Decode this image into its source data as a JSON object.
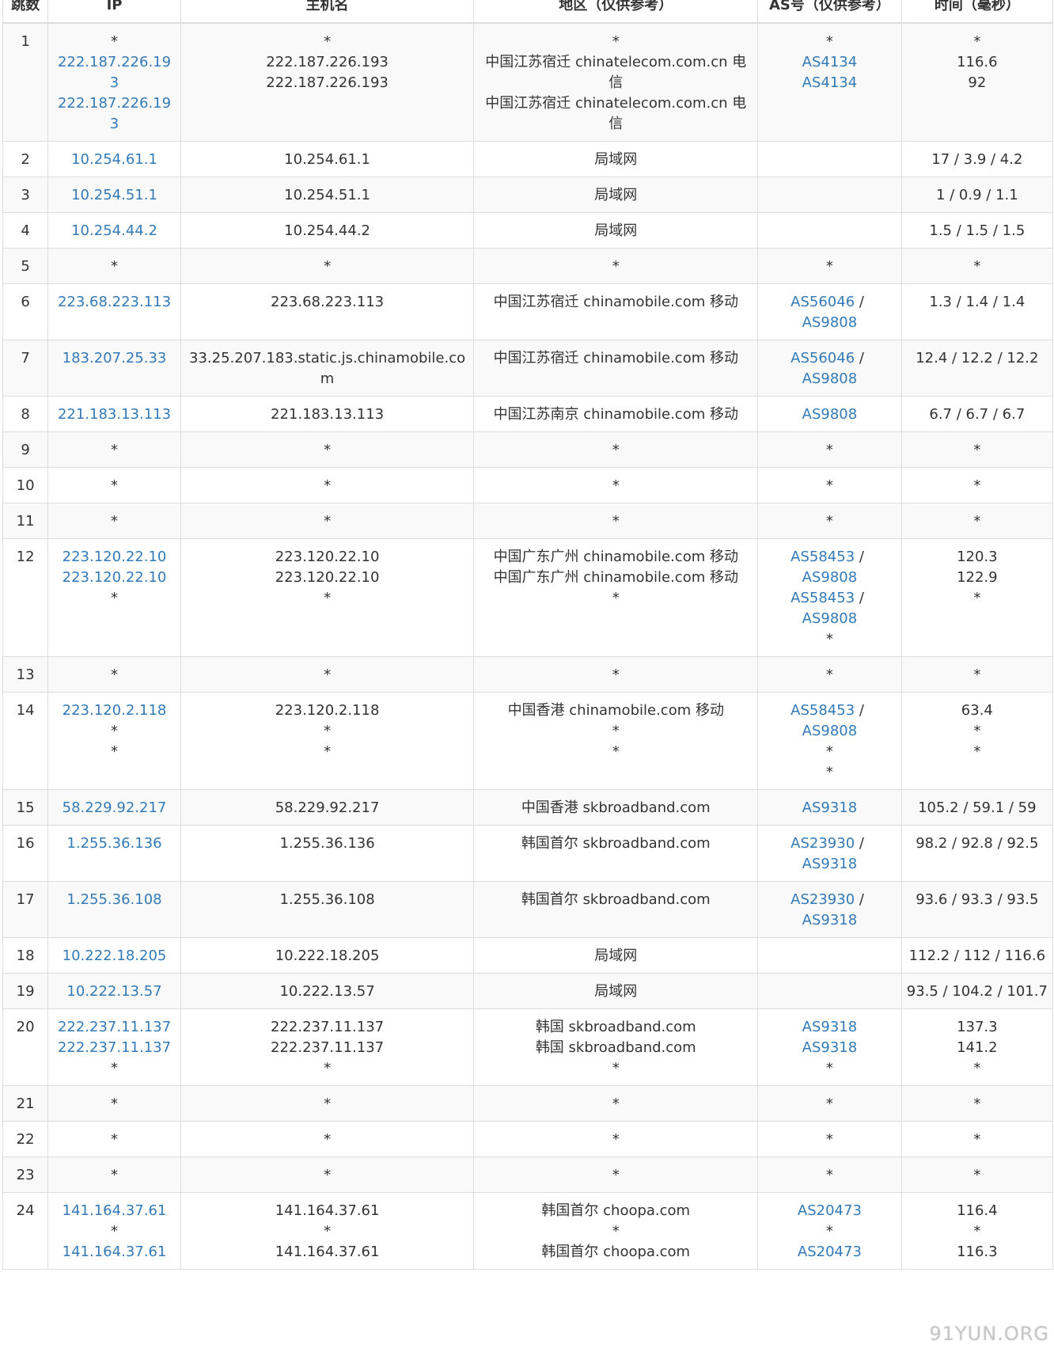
{
  "table": {
    "headers": [
      "跳数",
      "IP",
      "主机名",
      "地区（仅供参考）",
      "AS号（仅供参考）",
      "时间（毫秒）"
    ],
    "rows": [
      {
        "hop": "1",
        "ip": [
          {
            "t": "*"
          },
          {
            "t": "222.187.226.193",
            "link": true
          },
          {
            "t": "222.187.226.193",
            "link": true
          }
        ],
        "host": [
          {
            "t": "*"
          },
          {
            "t": "222.187.226.193"
          },
          {
            "t": "222.187.226.193"
          }
        ],
        "region": [
          {
            "t": "*"
          },
          {
            "t": "中国江苏宿迁 chinatelecom.com.cn 电信"
          },
          {
            "t": "中国江苏宿迁 chinatelecom.com.cn 电信"
          }
        ],
        "asn": [
          [
            {
              "t": "*"
            }
          ],
          [
            {
              "t": "AS4134",
              "link": true
            }
          ],
          [
            {
              "t": "AS4134",
              "link": true
            }
          ]
        ],
        "time": [
          {
            "t": "*"
          },
          {
            "t": "116.6"
          },
          {
            "t": "92"
          }
        ]
      },
      {
        "hop": "2",
        "ip": [
          {
            "t": "10.254.61.1",
            "link": true
          }
        ],
        "host": [
          {
            "t": "10.254.61.1"
          }
        ],
        "region": [
          {
            "t": "局域网"
          }
        ],
        "asn": [],
        "time": [
          {
            "t": "17 / 3.9 / 4.2"
          }
        ]
      },
      {
        "hop": "3",
        "ip": [
          {
            "t": "10.254.51.1",
            "link": true
          }
        ],
        "host": [
          {
            "t": "10.254.51.1"
          }
        ],
        "region": [
          {
            "t": "局域网"
          }
        ],
        "asn": [],
        "time": [
          {
            "t": "1 / 0.9 / 1.1"
          }
        ]
      },
      {
        "hop": "4",
        "ip": [
          {
            "t": "10.254.44.2",
            "link": true
          }
        ],
        "host": [
          {
            "t": "10.254.44.2"
          }
        ],
        "region": [
          {
            "t": "局域网"
          }
        ],
        "asn": [],
        "time": [
          {
            "t": "1.5 / 1.5 / 1.5"
          }
        ]
      },
      {
        "hop": "5",
        "ip": [
          {
            "t": "*"
          }
        ],
        "host": [
          {
            "t": "*"
          }
        ],
        "region": [
          {
            "t": "*"
          }
        ],
        "asn": [
          [
            {
              "t": "*"
            }
          ]
        ],
        "time": [
          {
            "t": "*"
          }
        ]
      },
      {
        "hop": "6",
        "ip": [
          {
            "t": "223.68.223.113",
            "link": true
          }
        ],
        "host": [
          {
            "t": "223.68.223.113"
          }
        ],
        "region": [
          {
            "t": "中国江苏宿迁 chinamobile.com 移动"
          }
        ],
        "asn": [
          [
            {
              "t": "AS56046",
              "link": true
            },
            {
              "t": " / "
            }
          ],
          [
            {
              "t": "AS9808",
              "link": true
            }
          ]
        ],
        "time": [
          {
            "t": "1.3 / 1.4 / 1.4"
          }
        ]
      },
      {
        "hop": "7",
        "ip": [
          {
            "t": "183.207.25.33",
            "link": true
          }
        ],
        "host": [
          {
            "t": "33.25.207.183.static.js.chinamobile.com"
          }
        ],
        "region": [
          {
            "t": "中国江苏宿迁 chinamobile.com 移动"
          }
        ],
        "asn": [
          [
            {
              "t": "AS56046",
              "link": true
            },
            {
              "t": " / "
            }
          ],
          [
            {
              "t": "AS9808",
              "link": true
            }
          ]
        ],
        "time": [
          {
            "t": "12.4 / 12.2 / 12.2"
          }
        ]
      },
      {
        "hop": "8",
        "ip": [
          {
            "t": "221.183.13.113",
            "link": true
          }
        ],
        "host": [
          {
            "t": "221.183.13.113"
          }
        ],
        "region": [
          {
            "t": "中国江苏南京 chinamobile.com 移动"
          }
        ],
        "asn": [
          [
            {
              "t": "AS9808",
              "link": true
            }
          ]
        ],
        "time": [
          {
            "t": "6.7 / 6.7 / 6.7"
          }
        ]
      },
      {
        "hop": "9",
        "ip": [
          {
            "t": "*"
          }
        ],
        "host": [
          {
            "t": "*"
          }
        ],
        "region": [
          {
            "t": "*"
          }
        ],
        "asn": [
          [
            {
              "t": "*"
            }
          ]
        ],
        "time": [
          {
            "t": "*"
          }
        ]
      },
      {
        "hop": "10",
        "ip": [
          {
            "t": "*"
          }
        ],
        "host": [
          {
            "t": "*"
          }
        ],
        "region": [
          {
            "t": "*"
          }
        ],
        "asn": [
          [
            {
              "t": "*"
            }
          ]
        ],
        "time": [
          {
            "t": "*"
          }
        ]
      },
      {
        "hop": "11",
        "ip": [
          {
            "t": "*"
          }
        ],
        "host": [
          {
            "t": "*"
          }
        ],
        "region": [
          {
            "t": "*"
          }
        ],
        "asn": [
          [
            {
              "t": "*"
            }
          ]
        ],
        "time": [
          {
            "t": "*"
          }
        ]
      },
      {
        "hop": "12",
        "ip": [
          {
            "t": "223.120.22.10",
            "link": true
          },
          {
            "t": "223.120.22.10",
            "link": true
          },
          {
            "t": "*"
          }
        ],
        "host": [
          {
            "t": "223.120.22.10"
          },
          {
            "t": "223.120.22.10"
          },
          {
            "t": "*"
          }
        ],
        "region": [
          {
            "t": "中国广东广州 chinamobile.com 移动"
          },
          {
            "t": "中国广东广州 chinamobile.com 移动"
          },
          {
            "t": "*"
          }
        ],
        "asn": [
          [
            {
              "t": "AS58453",
              "link": true
            },
            {
              "t": " / "
            }
          ],
          [
            {
              "t": "AS9808",
              "link": true
            }
          ],
          [
            {
              "t": "AS58453",
              "link": true
            },
            {
              "t": " / "
            }
          ],
          [
            {
              "t": "AS9808",
              "link": true
            }
          ],
          [
            {
              "t": "*"
            }
          ]
        ],
        "time": [
          {
            "t": "120.3"
          },
          {
            "t": "122.9"
          },
          {
            "t": "*"
          }
        ]
      },
      {
        "hop": "13",
        "ip": [
          {
            "t": "*"
          }
        ],
        "host": [
          {
            "t": "*"
          }
        ],
        "region": [
          {
            "t": "*"
          }
        ],
        "asn": [
          [
            {
              "t": "*"
            }
          ]
        ],
        "time": [
          {
            "t": "*"
          }
        ]
      },
      {
        "hop": "14",
        "ip": [
          {
            "t": "223.120.2.118",
            "link": true
          },
          {
            "t": "*"
          },
          {
            "t": "*"
          }
        ],
        "host": [
          {
            "t": "223.120.2.118"
          },
          {
            "t": "*"
          },
          {
            "t": "*"
          }
        ],
        "region": [
          {
            "t": "中国香港 chinamobile.com 移动"
          },
          {
            "t": "*"
          },
          {
            "t": "*"
          }
        ],
        "asn": [
          [
            {
              "t": "AS58453",
              "link": true
            },
            {
              "t": " / "
            }
          ],
          [
            {
              "t": "AS9808",
              "link": true
            }
          ],
          [
            {
              "t": "*"
            }
          ],
          [
            {
              "t": "*"
            }
          ]
        ],
        "time": [
          {
            "t": "63.4"
          },
          {
            "t": "*"
          },
          {
            "t": "*"
          }
        ]
      },
      {
        "hop": "15",
        "ip": [
          {
            "t": "58.229.92.217",
            "link": true
          }
        ],
        "host": [
          {
            "t": "58.229.92.217"
          }
        ],
        "region": [
          {
            "t": "中国香港 skbroadband.com"
          }
        ],
        "asn": [
          [
            {
              "t": "AS9318",
              "link": true
            }
          ]
        ],
        "time": [
          {
            "t": "105.2 / 59.1 / 59"
          }
        ]
      },
      {
        "hop": "16",
        "ip": [
          {
            "t": "1.255.36.136",
            "link": true
          }
        ],
        "host": [
          {
            "t": "1.255.36.136"
          }
        ],
        "region": [
          {
            "t": "韩国首尔 skbroadband.com"
          }
        ],
        "asn": [
          [
            {
              "t": "AS23930",
              "link": true
            },
            {
              "t": " / "
            }
          ],
          [
            {
              "t": "AS9318",
              "link": true
            }
          ]
        ],
        "time": [
          {
            "t": "98.2 / 92.8 / 92.5"
          }
        ]
      },
      {
        "hop": "17",
        "ip": [
          {
            "t": "1.255.36.108",
            "link": true
          }
        ],
        "host": [
          {
            "t": "1.255.36.108"
          }
        ],
        "region": [
          {
            "t": "韩国首尔 skbroadband.com"
          }
        ],
        "asn": [
          [
            {
              "t": "AS23930",
              "link": true
            },
            {
              "t": " / "
            }
          ],
          [
            {
              "t": "AS9318",
              "link": true
            }
          ]
        ],
        "time": [
          {
            "t": "93.6 / 93.3 / 93.5"
          }
        ]
      },
      {
        "hop": "18",
        "ip": [
          {
            "t": "10.222.18.205",
            "link": true
          }
        ],
        "host": [
          {
            "t": "10.222.18.205"
          }
        ],
        "region": [
          {
            "t": "局域网"
          }
        ],
        "asn": [],
        "time": [
          {
            "t": "112.2 / 112 / 116.6"
          }
        ]
      },
      {
        "hop": "19",
        "ip": [
          {
            "t": "10.222.13.57",
            "link": true
          }
        ],
        "host": [
          {
            "t": "10.222.13.57"
          }
        ],
        "region": [
          {
            "t": "局域网"
          }
        ],
        "asn": [],
        "time": [
          {
            "t": "93.5 / 104.2 / 101.7"
          }
        ]
      },
      {
        "hop": "20",
        "ip": [
          {
            "t": "222.237.11.137",
            "link": true
          },
          {
            "t": "222.237.11.137",
            "link": true
          },
          {
            "t": "*"
          }
        ],
        "host": [
          {
            "t": "222.237.11.137"
          },
          {
            "t": "222.237.11.137"
          },
          {
            "t": "*"
          }
        ],
        "region": [
          {
            "t": "韩国 skbroadband.com"
          },
          {
            "t": "韩国 skbroadband.com"
          },
          {
            "t": "*"
          }
        ],
        "asn": [
          [
            {
              "t": "AS9318",
              "link": true
            }
          ],
          [
            {
              "t": "AS9318",
              "link": true
            }
          ],
          [
            {
              "t": "*"
            }
          ]
        ],
        "time": [
          {
            "t": "137.3"
          },
          {
            "t": "141.2"
          },
          {
            "t": "*"
          }
        ]
      },
      {
        "hop": "21",
        "ip": [
          {
            "t": "*"
          }
        ],
        "host": [
          {
            "t": "*"
          }
        ],
        "region": [
          {
            "t": "*"
          }
        ],
        "asn": [
          [
            {
              "t": "*"
            }
          ]
        ],
        "time": [
          {
            "t": "*"
          }
        ]
      },
      {
        "hop": "22",
        "ip": [
          {
            "t": "*"
          }
        ],
        "host": [
          {
            "t": "*"
          }
        ],
        "region": [
          {
            "t": "*"
          }
        ],
        "asn": [
          [
            {
              "t": "*"
            }
          ]
        ],
        "time": [
          {
            "t": "*"
          }
        ]
      },
      {
        "hop": "23",
        "ip": [
          {
            "t": "*"
          }
        ],
        "host": [
          {
            "t": "*"
          }
        ],
        "region": [
          {
            "t": "*"
          }
        ],
        "asn": [
          [
            {
              "t": "*"
            }
          ]
        ],
        "time": [
          {
            "t": "*"
          }
        ]
      },
      {
        "hop": "24",
        "ip": [
          {
            "t": "141.164.37.61",
            "link": true
          },
          {
            "t": "*"
          },
          {
            "t": "141.164.37.61",
            "link": true
          }
        ],
        "host": [
          {
            "t": "141.164.37.61"
          },
          {
            "t": "*"
          },
          {
            "t": "141.164.37.61"
          }
        ],
        "region": [
          {
            "t": "韩国首尔 choopa.com"
          },
          {
            "t": "*"
          },
          {
            "t": "韩国首尔 choopa.com"
          }
        ],
        "asn": [
          [
            {
              "t": "AS20473",
              "link": true
            }
          ],
          [
            {
              "t": "*"
            }
          ],
          [
            {
              "t": "AS20473",
              "link": true
            }
          ]
        ],
        "time": [
          {
            "t": "116.4"
          },
          {
            "t": "*"
          },
          {
            "t": "116.3"
          }
        ]
      }
    ]
  },
  "watermark": "91YUN.ORG",
  "colors": {
    "link": "#337ab7",
    "border": "#dddddd",
    "stripe": "#f9f9f9",
    "text": "#333333"
  }
}
